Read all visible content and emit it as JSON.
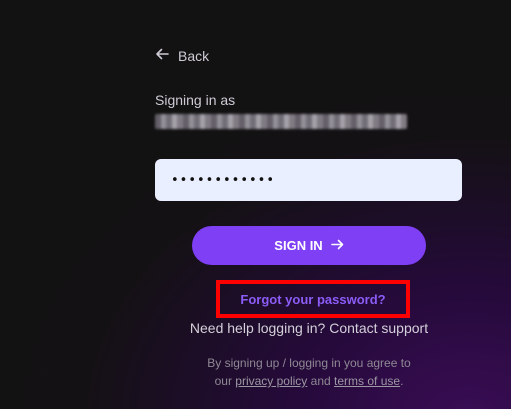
{
  "back": {
    "label": "Back"
  },
  "signin": {
    "label": "Signing in as",
    "password_value": "••••••••••••",
    "button_label": "SIGN IN"
  },
  "links": {
    "forgot": "Forgot your password?",
    "help_prefix": "Need help logging in?",
    "contact": "Contact support"
  },
  "legal": {
    "line1": "By signing up / logging in you agree to",
    "our": "our",
    "privacy": "privacy policy",
    "and": "and",
    "terms": "terms of use",
    "period": "."
  },
  "colors": {
    "accent": "#7f3ff5",
    "link": "#8b5cf6",
    "highlight": "#ff0000",
    "input_bg": "#e9efff"
  },
  "icons": {
    "back": "arrow-left-icon",
    "submit": "arrow-right-icon"
  }
}
